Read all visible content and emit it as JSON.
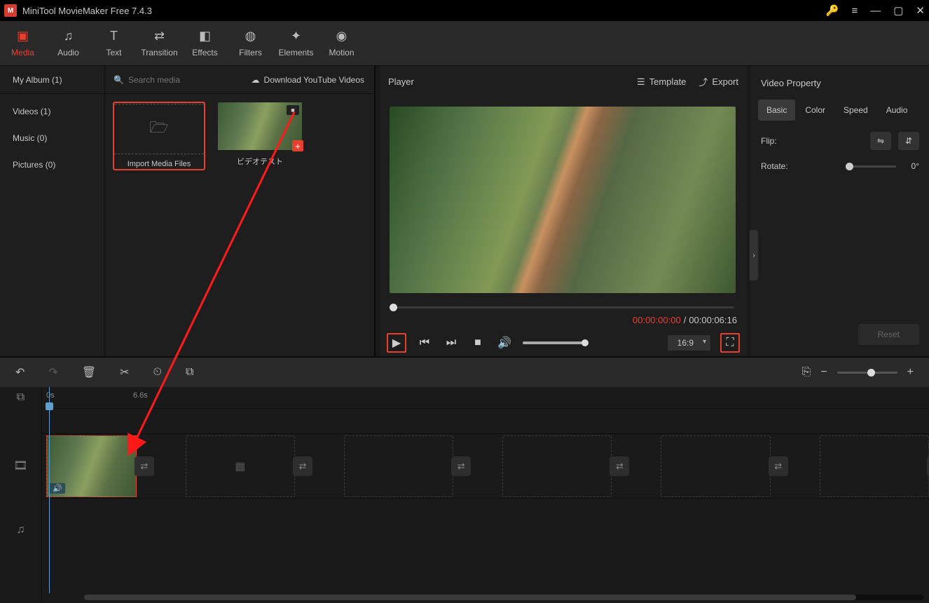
{
  "app": {
    "title": "MiniTool MovieMaker Free 7.4.3"
  },
  "ribbon": [
    {
      "label": "Media",
      "active": true
    },
    {
      "label": "Audio"
    },
    {
      "label": "Text"
    },
    {
      "label": "Transition"
    },
    {
      "label": "Effects"
    },
    {
      "label": "Filters"
    },
    {
      "label": "Elements"
    },
    {
      "label": "Motion"
    }
  ],
  "sidebar": {
    "album_label": "My Album (1)",
    "items": [
      {
        "label": "Videos (1)"
      },
      {
        "label": "Music (0)"
      },
      {
        "label": "Pictures (0)"
      }
    ]
  },
  "search": {
    "placeholder": "Search media"
  },
  "download_yt": "Download YouTube Videos",
  "import_label": "Import Media Files",
  "clip_name": "ビデオテスト",
  "player": {
    "title": "Player",
    "template": "Template",
    "export": "Export",
    "current": "00:00:00:00",
    "sep": "/",
    "total": "00:00:06:16",
    "ratio": "16:9"
  },
  "property": {
    "title": "Video Property",
    "tabs": [
      "Basic",
      "Color",
      "Speed",
      "Audio"
    ],
    "flip_label": "Flip:",
    "rotate_label": "Rotate:",
    "rotate_value": "0°",
    "reset": "Reset"
  },
  "ruler": {
    "t0": "0s",
    "t1": "6.6s"
  }
}
